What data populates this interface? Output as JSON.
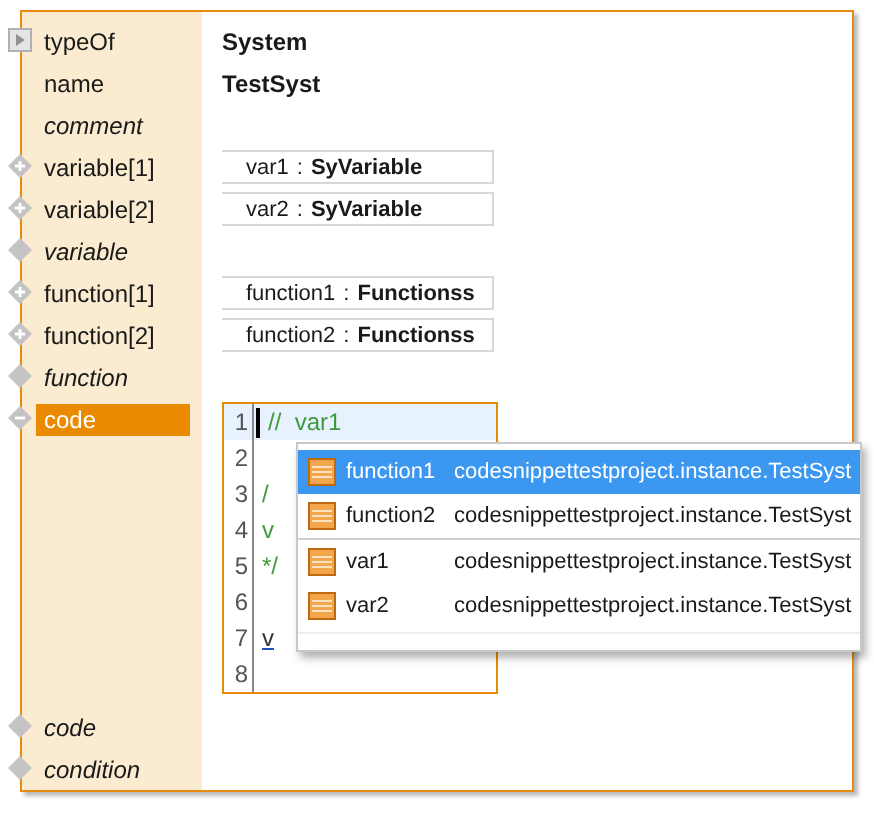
{
  "properties": [
    {
      "label": "typeOf",
      "italic": false,
      "kind": "play",
      "selected": false,
      "value": {
        "kind": "text",
        "text": "System"
      }
    },
    {
      "label": "name",
      "italic": false,
      "selected": false,
      "value": {
        "kind": "text",
        "text": "TestSyst"
      }
    },
    {
      "label": "comment",
      "italic": true,
      "selected": false
    },
    {
      "label": "variable[1]",
      "italic": false,
      "kind": "plus",
      "selected": false,
      "value": {
        "kind": "ref",
        "name": "var1",
        "sep": ":",
        "type": "SyVariable"
      }
    },
    {
      "label": "variable[2]",
      "italic": false,
      "kind": "plus",
      "selected": false,
      "value": {
        "kind": "ref",
        "name": "var2",
        "sep": ":",
        "type": "SyVariable"
      }
    },
    {
      "label": "variable",
      "italic": true,
      "kind": "plain",
      "selected": false
    },
    {
      "label": "function[1]",
      "italic": false,
      "kind": "plus",
      "selected": false,
      "value": {
        "kind": "ref",
        "name": "function1",
        "sep": ":",
        "type": "Functionss"
      }
    },
    {
      "label": "function[2]",
      "italic": false,
      "kind": "plus",
      "selected": false,
      "value": {
        "kind": "ref",
        "name": "function2",
        "sep": ":",
        "type": "Functionss"
      }
    },
    {
      "label": "function",
      "italic": true,
      "kind": "plain",
      "selected": false
    },
    {
      "label": "code",
      "italic": false,
      "kind": "minus",
      "selected": true,
      "value": {
        "kind": "editor"
      }
    },
    {
      "label": "code",
      "italic": true,
      "kind": "plain",
      "selected": false
    },
    {
      "label": "condition",
      "italic": true,
      "kind": "plain",
      "selected": false
    }
  ],
  "editor": {
    "lines": [
      {
        "number": "1",
        "text": "//  var1",
        "kind": "comment",
        "current": true
      },
      {
        "number": "2",
        "current": false
      },
      {
        "number": "3",
        "text": "/",
        "kind": "comment",
        "current": false
      },
      {
        "number": "4",
        "text": "v",
        "kind": "comment",
        "current": false
      },
      {
        "number": "5",
        "text": "*/",
        "kind": "comment",
        "current": false
      },
      {
        "number": "6",
        "current": false
      },
      {
        "number": "7",
        "text": "v",
        "kind": "link",
        "current": false
      },
      {
        "number": "8",
        "current": false
      }
    ]
  },
  "completion": {
    "items": [
      {
        "name": "function1",
        "owner": "codesnippettestproject.instance.TestSyst",
        "selected": true,
        "group_end": false
      },
      {
        "name": "function2",
        "owner": "codesnippettestproject.instance.TestSyst",
        "selected": false,
        "group_end": true
      },
      {
        "name": "var1",
        "owner": "codesnippettestproject.instance.TestSyst",
        "selected": false,
        "group_end": false
      },
      {
        "name": "var2",
        "owner": "codesnippettestproject.instance.TestSyst",
        "selected": false,
        "group_end": false
      }
    ]
  }
}
